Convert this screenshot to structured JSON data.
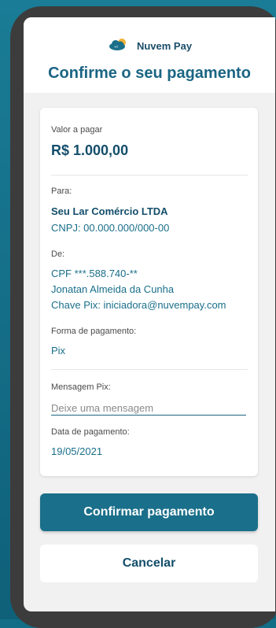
{
  "header": {
    "brand_name": "Nuvem Pay",
    "logo_icon": "cloud-sun-icon",
    "title": "Confirme o seu pagamento"
  },
  "payment": {
    "amount_label": "Valor a pagar",
    "amount": "R$ 1.000,00",
    "to_label": "Para:",
    "to_name": "Seu Lar Comércio LTDA",
    "to_cnpj": "CNPJ: 00.000.000/000-00",
    "from_label": "De:",
    "from_cpf": "CPF ***.588.740-**",
    "from_name": "Jonatan Almeida da Cunha",
    "from_pix_key": "Chave Pix: iniciadora@nuvempay.com",
    "method_label": "Forma de pagamento:",
    "method": "Pix",
    "message_label": "Mensagem Pix:",
    "message_placeholder": "Deixe uma mensagem",
    "message_value": "",
    "date_label": "Data de pagamento:",
    "date": "19/05/2021"
  },
  "actions": {
    "confirm_label": "Confirmar pagamento",
    "cancel_label": "Cancelar"
  },
  "colors": {
    "background": "#126e87",
    "accent": "#1a6f8a",
    "heading": "#134e6b"
  }
}
